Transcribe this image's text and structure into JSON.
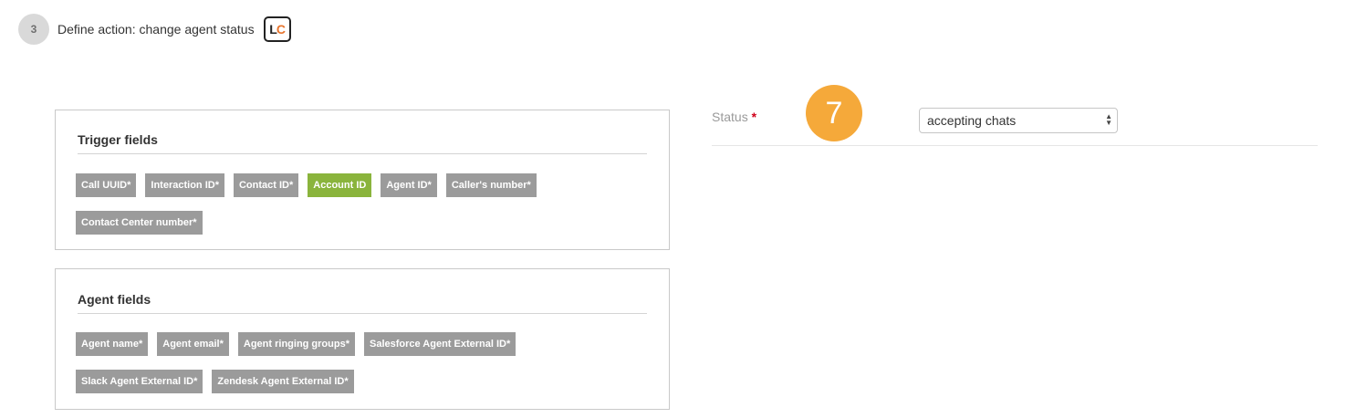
{
  "step": {
    "number": "3",
    "title": "Define action: change agent status",
    "logo_text_l": "L",
    "logo_text_c": "C",
    "logo_icon": "livechat-logo-icon"
  },
  "trigger_panel": {
    "title": "Trigger fields",
    "tags": [
      "Call UUID*",
      "Interaction ID*",
      "Contact ID*",
      "Account ID",
      "Agent ID*",
      "Caller's number*",
      "Contact Center number*"
    ],
    "active_tag": "Account ID"
  },
  "agent_panel": {
    "title": "Agent fields",
    "tags": [
      "Agent name*",
      "Agent email*",
      "Agent ringing groups*",
      "Salesforce Agent External ID*",
      "Slack Agent External ID*",
      "Zendesk Agent External ID*"
    ]
  },
  "status_field": {
    "label": "Status",
    "required_marker": "*",
    "selected_value": "accepting chats",
    "arrow_up": "▲",
    "arrow_down": "▼"
  },
  "marker": {
    "number": "7"
  },
  "colors": {
    "tag_default": "#9b9b9b",
    "tag_active": "#8ab43c",
    "marker": "#f5a93a",
    "logo_accent": "#e8742c",
    "required": "#d0021b"
  }
}
